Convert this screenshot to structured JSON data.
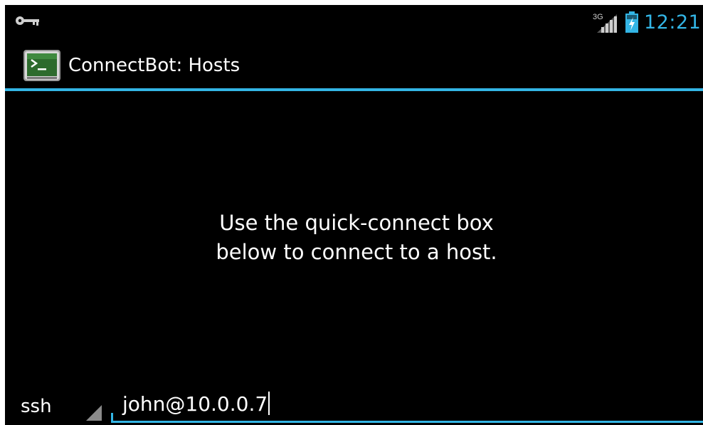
{
  "status_bar": {
    "time": "12:21",
    "network_label": "3G",
    "accent_color": "#33b5e5",
    "icons": [
      "key-icon",
      "signal-3g-icon",
      "battery-charging-icon"
    ]
  },
  "action_bar": {
    "title": "ConnectBot: Hosts",
    "icon": "terminal-app-icon"
  },
  "content": {
    "empty_message": "Use the quick-connect box\nbelow to connect to a host."
  },
  "quick_connect": {
    "protocol": "ssh",
    "input_value": "john@10.0.0.7"
  }
}
